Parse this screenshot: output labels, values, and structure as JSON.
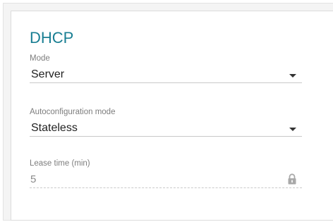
{
  "section": {
    "title": "DHCP"
  },
  "fields": {
    "mode": {
      "label": "Mode",
      "value": "Server"
    },
    "autoconfig": {
      "label": "Autoconfiguration mode",
      "value": "Stateless"
    },
    "lease": {
      "label": "Lease time (min)",
      "value": "5",
      "locked_icon": "lock-icon"
    }
  },
  "colors": {
    "accent": "#1a7f93",
    "label": "#7d7d7d",
    "value": "#222222",
    "disabled_value": "#8a8a8a",
    "divider": "#c9c9c9"
  }
}
